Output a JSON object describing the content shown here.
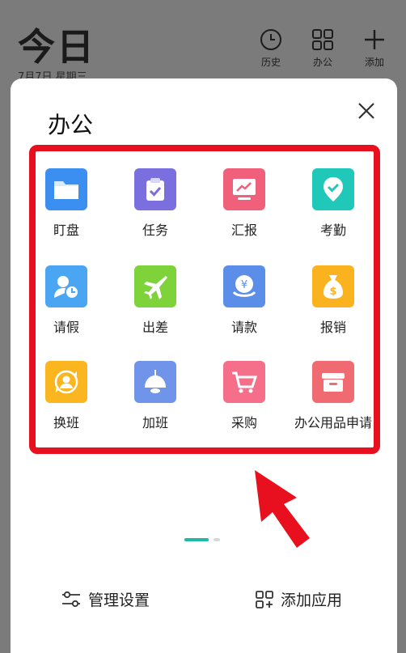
{
  "background": {
    "title": "今日",
    "date": "7月7日 星期三",
    "actions": [
      {
        "label": "历史",
        "icon": "clock-icon"
      },
      {
        "label": "办公",
        "icon": "grid-icon"
      },
      {
        "label": "添加",
        "icon": "plus-icon"
      }
    ]
  },
  "sheet": {
    "title": "办公",
    "close_icon": "close-icon",
    "apps": [
      {
        "label": "盯盘",
        "icon": "folder-icon",
        "color": "#3b8ff0"
      },
      {
        "label": "任务",
        "icon": "clipboard-check-icon",
        "color": "#7b6fe0"
      },
      {
        "label": "汇报",
        "icon": "chart-board-icon",
        "color": "#f0607a"
      },
      {
        "label": "考勤",
        "icon": "location-check-icon",
        "color": "#1fc8b8"
      },
      {
        "label": "请假",
        "icon": "user-clock-icon",
        "color": "#4aa6f2"
      },
      {
        "label": "出差",
        "icon": "airplane-icon",
        "color": "#7ed23a"
      },
      {
        "label": "请款",
        "icon": "coin-stack-icon",
        "color": "#5a8ee8"
      },
      {
        "label": "报销",
        "icon": "money-bag-icon",
        "color": "#fbb21f"
      },
      {
        "label": "换班",
        "icon": "user-swap-icon",
        "color": "#fbb61f"
      },
      {
        "label": "加班",
        "icon": "lamp-icon",
        "color": "#6f94ea"
      },
      {
        "label": "采购",
        "icon": "cart-icon",
        "color": "#f56e8a"
      },
      {
        "label": "办公用品申请",
        "icon": "supply-box-icon",
        "color": "#f06a72"
      }
    ],
    "footer": {
      "manage_label": "管理设置",
      "add_label": "添加应用"
    }
  },
  "colors": {
    "highlight": "#e8101e",
    "pager_active": "#22b8a4"
  }
}
